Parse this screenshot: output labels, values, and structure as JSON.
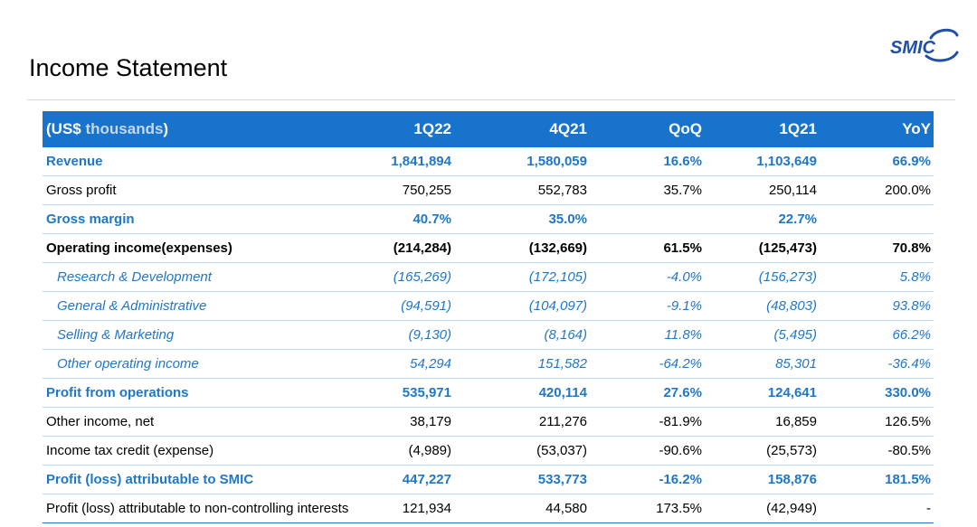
{
  "header": {
    "title": "Income Statement",
    "logo_text": "SMIC"
  },
  "table": {
    "columns": [
      "(US$ thousands)",
      "1Q22",
      "4Q21",
      "QoQ",
      "1Q21",
      "YoY"
    ],
    "unit_prefix": "(US$ ",
    "unit_word": "thousands",
    "unit_suffix": ")",
    "rows": [
      {
        "style": "hl",
        "cells": [
          "Revenue",
          "1,841,894",
          "1,580,059",
          "16.6%",
          "1,103,649",
          "66.9%"
        ]
      },
      {
        "style": "normal",
        "cells": [
          "Gross profit",
          "750,255",
          "552,783",
          "35.7%",
          "250,114",
          "200.0%"
        ]
      },
      {
        "style": "hl",
        "cells": [
          "Gross margin",
          "40.7%",
          "35.0%",
          "",
          "22.7%",
          ""
        ]
      },
      {
        "style": "bold",
        "cells": [
          "Operating income(expenses)",
          "(214,284)",
          "(132,669)",
          "61.5%",
          "(125,473)",
          "70.8%"
        ]
      },
      {
        "style": "sub",
        "cells": [
          "Research & Development",
          "(165,269)",
          "(172,105)",
          "-4.0%",
          "(156,273)",
          "5.8%"
        ]
      },
      {
        "style": "sub",
        "cells": [
          "General & Administrative",
          "(94,591)",
          "(104,097)",
          "-9.1%",
          "(48,803)",
          "93.8%"
        ]
      },
      {
        "style": "sub",
        "cells": [
          "Selling & Marketing",
          "(9,130)",
          "(8,164)",
          "11.8%",
          "(5,495)",
          "66.2%"
        ]
      },
      {
        "style": "sub",
        "cells": [
          "Other operating income",
          "54,294",
          "151,582",
          "-64.2%",
          "85,301",
          "-36.4%"
        ]
      },
      {
        "style": "hl",
        "cells": [
          "Profit from operations",
          "535,971",
          "420,114",
          "27.6%",
          "124,641",
          "330.0%"
        ]
      },
      {
        "style": "normal",
        "cells": [
          "Other income, net",
          "38,179",
          "211,276",
          "-81.9%",
          "16,859",
          "126.5%"
        ]
      },
      {
        "style": "normal",
        "cells": [
          "Income tax credit (expense)",
          "(4,989)",
          "(53,037)",
          "-90.6%",
          "(25,573)",
          "-80.5%"
        ]
      },
      {
        "style": "hl",
        "cells": [
          "Profit (loss) attributable to SMIC",
          "447,227",
          "533,773",
          "-16.2%",
          "158,876",
          "181.5%"
        ]
      },
      {
        "style": "normal",
        "cells": [
          "Profit (loss) attributable to non-controlling interests",
          "121,934",
          "44,580",
          "173.5%",
          "(42,949)",
          "-"
        ]
      }
    ]
  },
  "colors": {
    "header_bg": "#1873cc",
    "highlight_text": "#1f77c6",
    "row_border": "#b9d7ee",
    "logo": "#1f4fa8"
  }
}
